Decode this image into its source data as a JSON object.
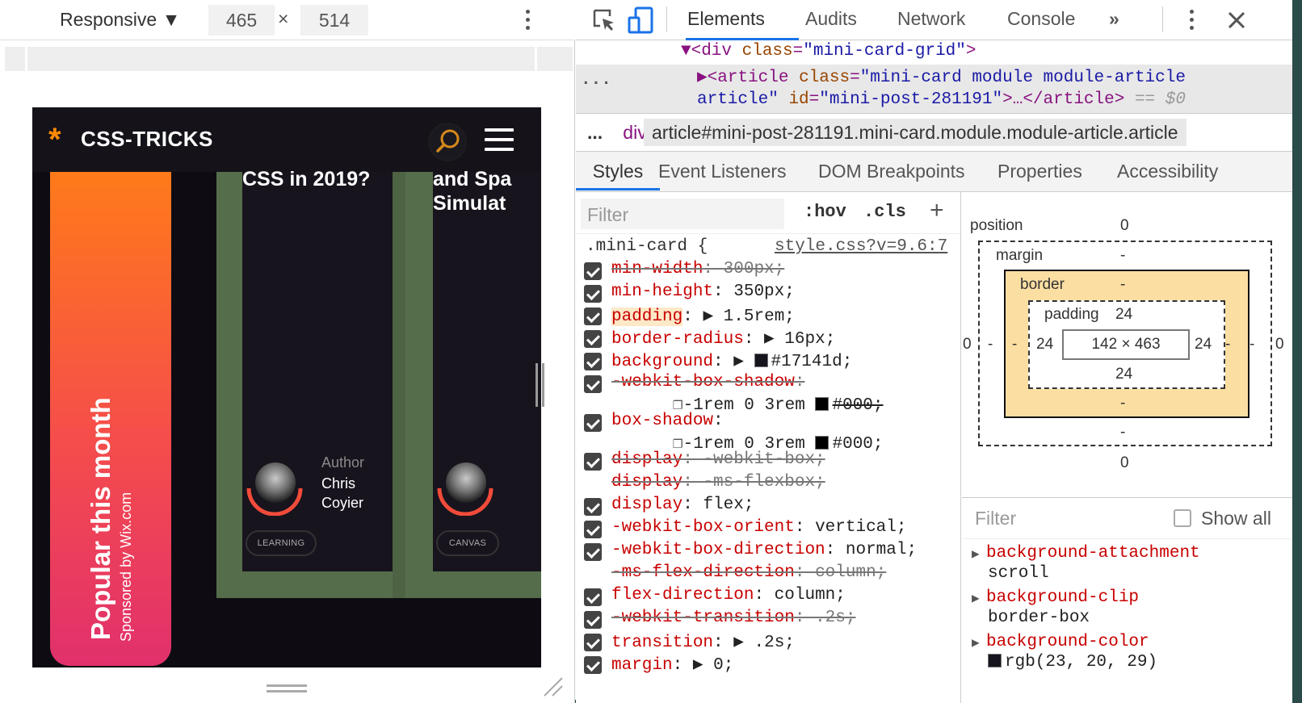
{
  "device_toolbar": {
    "mode_label": "Responsive ▼",
    "width": "465",
    "times": "×",
    "height": "514"
  },
  "site": {
    "logo_star": "*",
    "logo_text": "CSS-TRICKS",
    "popular_title": "Popular this month",
    "sponsor": "Sponsored by Wix.com",
    "card1_title": "CSS in 2019?",
    "card2_title_1": "and Spa",
    "card2_title_2": "Simulat",
    "author_label": "Author",
    "author_name_1": "Chris",
    "author_name_2": "Coyier",
    "tag1": "LEARNING",
    "tag2": "CANVAS",
    "colors": {
      "accent_orange": "#ff8a00",
      "card_bg": "#17141d",
      "highlight": "#566d4b"
    }
  },
  "devtools": {
    "tabs": [
      "Elements",
      "Audits",
      "Network",
      "Console",
      "»"
    ],
    "active_tab": "Elements",
    "dom": {
      "line1_tag_open": "▼<div",
      "line1_attr": "class",
      "line1_val": "\"mini-card-grid\"",
      "line1_close": ">",
      "ellipsis": "...",
      "line2_arrow": "▶<article",
      "line2_attr": "class",
      "line2_val": "\"mini-card module module-article",
      "line3_val": "article\"",
      "line3_id_attr": "id",
      "line3_id_val": "\"mini-post-281191\"",
      "line3_rest": ">…</article>",
      "line3_eq": "== $0"
    },
    "breadcrumb": {
      "ellipsis": "...",
      "div": "div",
      "selector": "article#mini-post-281191.mini-card.module.module-article.article"
    },
    "subtabs": [
      "Styles",
      "Event Listeners",
      "DOM Breakpoints",
      "Properties",
      "Accessibility"
    ],
    "styles_filter_placeholder": "Filter",
    "hov": ":hov",
    "cls": ".cls",
    "plus": "+",
    "rule_selector": ".mini-card {",
    "rule_source": "style.css?v=9.6:7",
    "declarations": [
      {
        "name": "min-width",
        "value": "300px;",
        "struck": true
      },
      {
        "name": "min-height",
        "value": "350px;",
        "struck": false
      },
      {
        "name": "padding",
        "value": "▶ 1.5rem;",
        "struck": false
      },
      {
        "name": "border-radius",
        "value": "▶ 16px;",
        "struck": false
      },
      {
        "name": "background",
        "value": "▶ #17141d;",
        "struck": false
      },
      {
        "name": "-webkit-box-shadow",
        "value": "",
        "struck": true
      },
      {
        "name": "box-shadow",
        "value": "",
        "struck": false
      },
      {
        "name": "display",
        "value": "-webkit-box;",
        "struck": true
      },
      {
        "name": "display",
        "value": "-ms-flexbox;",
        "struck": true
      },
      {
        "name": "display",
        "value": "flex;",
        "struck": false
      },
      {
        "name": "-webkit-box-orient",
        "value": "vertical;",
        "struck": false
      },
      {
        "name": "-webkit-box-direction",
        "value": "normal;",
        "struck": false
      },
      {
        "name": "-ms-flex-direction",
        "value": "column;",
        "struck": true
      },
      {
        "name": "flex-direction",
        "value": "column;",
        "struck": false
      },
      {
        "name": "-webkit-transition",
        "value": ".2s;",
        "struck": true
      },
      {
        "name": "transition",
        "value": "▶ .2s;",
        "struck": false
      },
      {
        "name": "margin",
        "value": "▶ 0;",
        "struck": false
      }
    ],
    "shadow_value_1": "-1rem 0 3rem ",
    "shadow_color_1": "#000;",
    "shadow_value_2": "-1rem 0 3rem ",
    "shadow_color_2": "#000;",
    "box_model": {
      "position_label": "position",
      "position_top": "0",
      "position_bottom": "0",
      "position_left": "0",
      "position_right": "0",
      "margin_label": "margin",
      "margin_top": "-",
      "margin_bottom": "-",
      "margin_left": "-",
      "margin_right": "-",
      "border_label": "border",
      "border_top": "-",
      "border_bottom": "-",
      "border_left": "-",
      "border_right": "-",
      "padding_label": "padding",
      "padding_top": "24",
      "padding_bottom": "24",
      "padding_left": "24",
      "padding_right": "24",
      "content": "142 × 463"
    },
    "computed_filter": "Filter",
    "show_all": "Show all",
    "computed": [
      {
        "name": "background-attachment",
        "value": "scroll"
      },
      {
        "name": "background-clip",
        "value": "border-box"
      },
      {
        "name": "background-color",
        "value": "rgb(23, 20, 29)"
      }
    ]
  }
}
